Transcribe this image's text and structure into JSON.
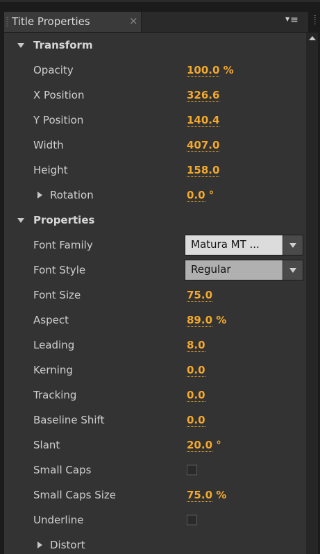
{
  "panel": {
    "tab_title": "Title Properties",
    "close_glyph": "×",
    "menu_glyph": "≡"
  },
  "groups": {
    "transform": {
      "label": "Transform",
      "opacity": {
        "label": "Opacity",
        "value": "100.0",
        "unit": " %"
      },
      "x_position": {
        "label": "X Position",
        "value": "326.6",
        "unit": ""
      },
      "y_position": {
        "label": "Y Position",
        "value": "140.4",
        "unit": ""
      },
      "width": {
        "label": "Width",
        "value": "407.0",
        "unit": ""
      },
      "height": {
        "label": "Height",
        "value": "158.0",
        "unit": ""
      },
      "rotation": {
        "label": "Rotation",
        "value": "0.0",
        "unit": " °"
      }
    },
    "properties": {
      "label": "Properties",
      "font_family": {
        "label": "Font Family",
        "value": "Matura MT ..."
      },
      "font_style": {
        "label": "Font Style",
        "value": "Regular"
      },
      "font_size": {
        "label": "Font Size",
        "value": "75.0",
        "unit": ""
      },
      "aspect": {
        "label": "Aspect",
        "value": "89.0",
        "unit": " %"
      },
      "leading": {
        "label": "Leading",
        "value": "8.0",
        "unit": ""
      },
      "kerning": {
        "label": "Kerning",
        "value": "0.0",
        "unit": ""
      },
      "tracking": {
        "label": "Tracking",
        "value": "0.0",
        "unit": ""
      },
      "baseline_shift": {
        "label": "Baseline Shift",
        "value": "0.0",
        "unit": ""
      },
      "slant": {
        "label": "Slant",
        "value": "20.0",
        "unit": " °"
      },
      "small_caps": {
        "label": "Small Caps",
        "checked": false
      },
      "small_caps_size": {
        "label": "Small Caps Size",
        "value": "75.0",
        "unit": " %"
      },
      "underline": {
        "label": "Underline",
        "checked": false
      },
      "distort": {
        "label": "Distort"
      }
    }
  },
  "icons": {
    "tab_grip": "grip-icon",
    "close": "close-icon",
    "panel_menu": "panel-menu-icon",
    "expand_open": "triangle-down-icon",
    "expand_closed": "triangle-right-icon",
    "dropdown": "chevron-down-icon",
    "scroll_up": "scroll-up-arrow-icon"
  },
  "colors": {
    "value_accent": "#f4a92b",
    "panel_bg": "#333333",
    "tab_bg": "#3a3a3a"
  }
}
